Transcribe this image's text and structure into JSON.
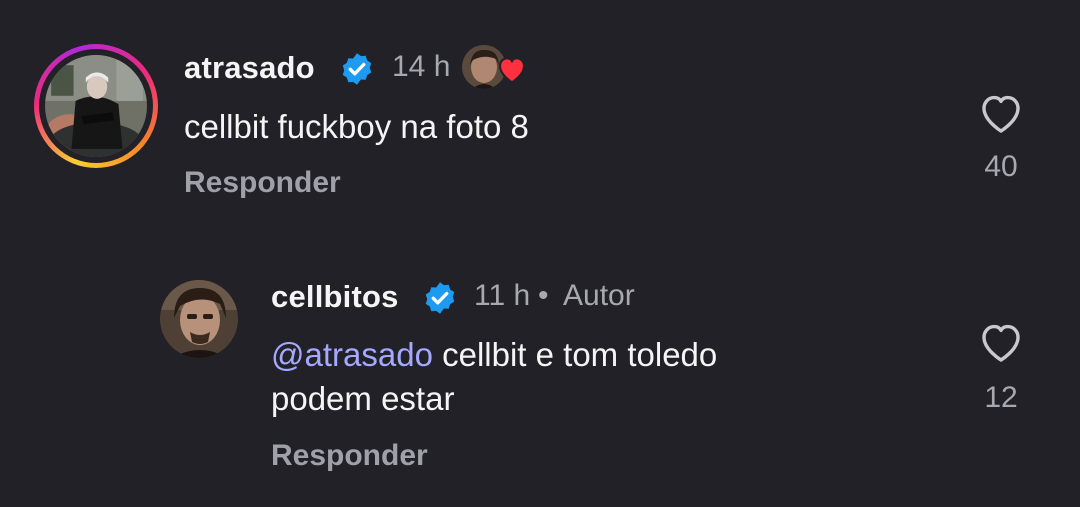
{
  "comments": [
    {
      "username": "atrasado",
      "verified": true,
      "time": "14 h",
      "text": "cellbit fuckboy na foto 8",
      "reply_label": "Responder",
      "like_count": "40",
      "liked_by_author": true
    }
  ],
  "replies": [
    {
      "username": "cellbitos",
      "verified": true,
      "time": "11 h",
      "separator": "•",
      "author_tag": "Autor",
      "mention": "@atrasado",
      "text_line1": " cellbit e tom toledo",
      "text_line2": "podem estar",
      "reply_label": "Responder",
      "like_count": "12"
    }
  ],
  "colors": {
    "background": "#212127",
    "verified_badge": "#1d9bf0",
    "mention": "#a5a8ff",
    "heart": "#ff3040"
  },
  "icons": {
    "verified": "verified-badge-icon",
    "like": "heart-outline-icon",
    "liked_by_author": "heart-filled-icon"
  }
}
